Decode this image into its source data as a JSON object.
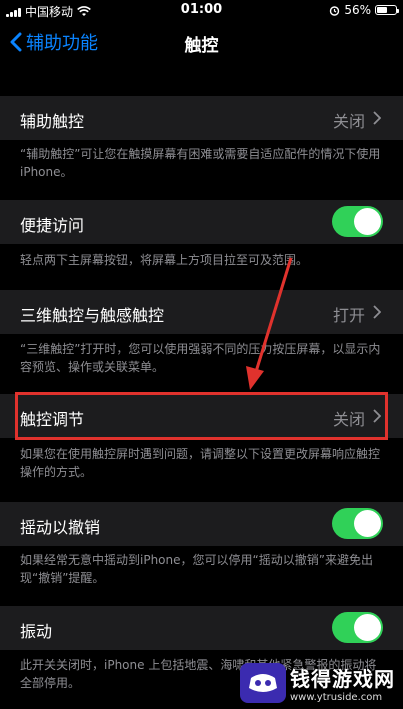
{
  "status": {
    "carrier": "中国移动",
    "time": "01:00",
    "battery": "56%",
    "battery_level": 0.56
  },
  "nav": {
    "back_label": "辅助功能",
    "title": "触控"
  },
  "sections": {
    "assistive_touch": {
      "label": "辅助触控",
      "value": "关闭",
      "footer": "“辅助触控”可让您在触摸屏幕有困难或需要自适应配件的情况下使用 iPhone。"
    },
    "reachability": {
      "label": "便捷访问",
      "toggle_on": true,
      "footer": "轻点两下主屏幕按钮，将屏幕上方项目拉至可及范围。"
    },
    "touch_3d": {
      "label": "三维触控与触感触控",
      "value": "打开",
      "footer": "“三维触控”打开时，您可以使用强弱不同的压力按压屏幕，以显示内容预览、操作或关联菜单。"
    },
    "touch_accommodations": {
      "label": "触控调节",
      "value": "关闭",
      "footer": "如果您在使用触控屏时遇到问题，请调整以下设置更改屏幕响应触控操作的方式。"
    },
    "shake_to_undo": {
      "label": "摇动以撤销",
      "toggle_on": true,
      "footer": "如果经常无意中摇动到iPhone，您可以停用“摇动以撤销”来避免出现“撤销”提醒。"
    },
    "vibration": {
      "label": "振动",
      "toggle_on": true,
      "footer": "此开关关闭时，iPhone 上包括地震、海啸和其他紧急警报的振动将全部停用。"
    }
  },
  "watermark": {
    "title": "钱得游戏网",
    "url": "www.ytruside.com"
  },
  "colors": {
    "accent": "#0a84ff",
    "toggle_on": "#30d158",
    "highlight": "#e0322d"
  }
}
